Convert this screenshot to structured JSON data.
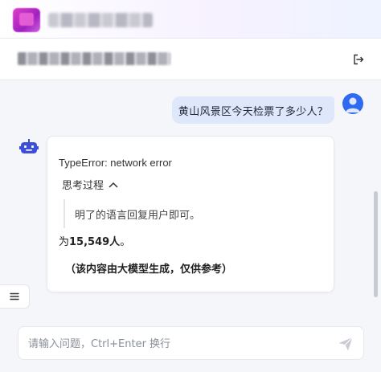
{
  "app": {
    "title": "",
    "conversation_title": ""
  },
  "header": {
    "logout_icon": "logout-icon"
  },
  "messages": {
    "user": {
      "text": "黄山风景区今天检票了多少人？"
    },
    "bot": {
      "error": "TypeError: network error",
      "thinking_label": "思考过程",
      "thinking_text": "明了的语言回复用户即可。",
      "answer_prefix": "为",
      "answer_value": "15,549人",
      "answer_suffix": "。",
      "disclaimer": "（该内容由大模型生成，仅供参考）"
    }
  },
  "input": {
    "placeholder": "请输入问题，Ctrl+Enter 换行",
    "value": ""
  },
  "colors": {
    "accent": "#2f6bf0",
    "user_bubble": "#dfe7fb",
    "background": "#f4f6fa"
  },
  "icons": {
    "menu": "menu-icon",
    "send": "send-icon",
    "chevron": "chevron-up-icon",
    "bot": "robot-icon",
    "user": "user-avatar"
  }
}
